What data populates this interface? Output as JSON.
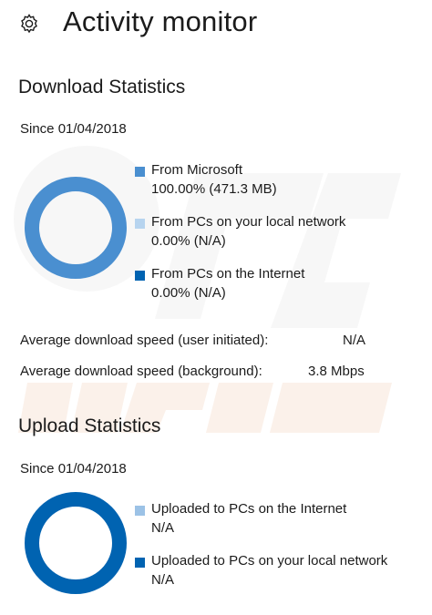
{
  "page": {
    "title": "Activity monitor"
  },
  "icons": {
    "settings": "gear-icon"
  },
  "colors": {
    "from_microsoft": "#4a8fd0",
    "local_network": "#b7d4ef",
    "internet": "#0063b1",
    "upload_internet": "#9cc2e6",
    "upload_local": "#0063b1"
  },
  "download": {
    "heading": "Download Statistics",
    "since": "Since 01/04/2018",
    "legend": [
      {
        "name": "From Microsoft",
        "value": "100.00%  (471.3 MB)"
      },
      {
        "name": "From PCs on your local network",
        "value": "0.00%  (N/A)"
      },
      {
        "name": "From PCs on the Internet",
        "value": "0.00%  (N/A)"
      }
    ],
    "avg_user_label": "Average download speed (user initiated):",
    "avg_user_value": "N/A",
    "avg_bg_label": "Average download speed (background):",
    "avg_bg_value": "3.8 Mbps"
  },
  "upload": {
    "heading": "Upload Statistics",
    "since": "Since 01/04/2018",
    "legend": [
      {
        "name": "Uploaded to PCs on the Internet",
        "value": "N/A"
      },
      {
        "name": "Uploaded to PCs on your local network",
        "value": "N/A"
      }
    ]
  }
}
